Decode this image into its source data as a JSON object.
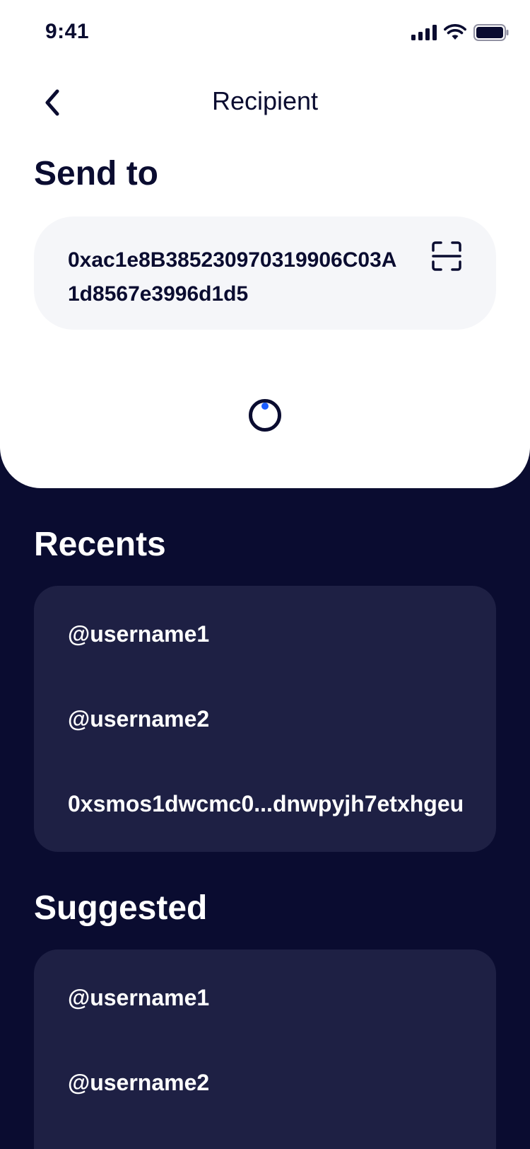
{
  "status_bar": {
    "time": "9:41"
  },
  "nav": {
    "title": "Recipient",
    "back_icon": "chevron-left-icon"
  },
  "send_to": {
    "heading": "Send to",
    "address": "0xac1e8B385230970319906C03A1d8567e3996d1d5",
    "scan_icon": "qr-scan-icon"
  },
  "recents": {
    "heading": "Recents",
    "items": [
      {
        "label": "@username1"
      },
      {
        "label": "@username2"
      },
      {
        "label": "0xsmos1dwcmc0...dnwpyjh7etxhgeu"
      }
    ]
  },
  "suggested": {
    "heading": "Suggested",
    "items": [
      {
        "label": "@username1"
      },
      {
        "label": "@username2"
      }
    ]
  },
  "colors": {
    "background_dark": "#0a0c30",
    "card_dark": "#1e2044",
    "sheet_light": "#ffffff",
    "field_light": "#f5f6f9",
    "accent_blue": "#1a5cff"
  }
}
